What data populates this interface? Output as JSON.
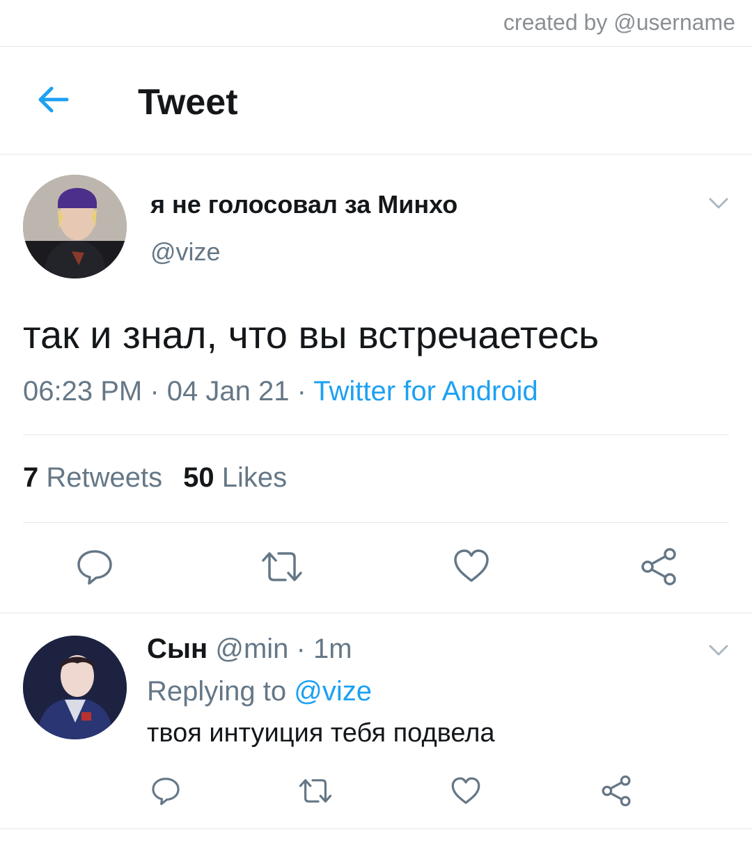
{
  "credit": "created by @username",
  "header": {
    "title": "Tweet"
  },
  "tweet": {
    "display_name": "я не голосовал за Минхо",
    "handle": "@vize",
    "text": "так и знал, что вы встречаетесь",
    "time": "06:23 PM",
    "date": "04 Jan 21",
    "source": "Twitter for Android",
    "meta_separator": " · ",
    "retweet_count": "7",
    "retweets_label": "Retweets",
    "like_count": "50",
    "likes_label": "Likes"
  },
  "reply": {
    "display_name": "Сын",
    "handle": "@min",
    "time_ago": "1m",
    "replying_label": "Replying to",
    "replying_to": "@vize",
    "text": "твоя интуиция тебя подвела"
  },
  "colors": {
    "accent": "#1da1f2",
    "secondary_text": "#657786",
    "primary_text": "#14171a"
  },
  "icons": {
    "back": "arrow-left-icon",
    "menu": "chevron-down-icon",
    "reply": "comment-icon",
    "retweet": "retweet-icon",
    "like": "heart-icon",
    "share": "share-icon"
  }
}
